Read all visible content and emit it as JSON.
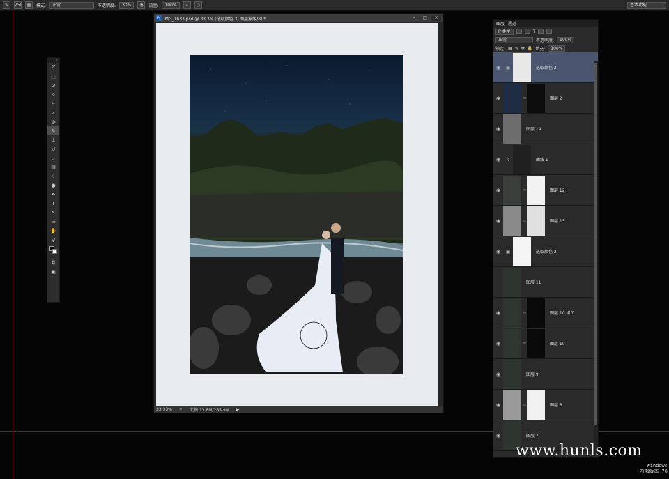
{
  "options_bar": {
    "brush_size": "250",
    "mode_label": "模式:",
    "mode_value": "正常",
    "opacity_label": "不透明度:",
    "opacity_value": "30%",
    "flow_label": "流量:",
    "flow_value": "100%",
    "workspace": "基本功能"
  },
  "document": {
    "title": "IMG_1633.psd @ 33.3% (选取颜色 3, 图层蒙版/8) *",
    "zoom": "33.33%",
    "doc_size": "文档:13.8M/265.9M"
  },
  "layers_panel": {
    "tabs": [
      "图层",
      "通道"
    ],
    "kind_filter": "P 类型",
    "blend_mode": "正常",
    "opacity_label": "不透明度:",
    "opacity_value": "100%",
    "lock_label": "锁定:",
    "fill_label": "填充:",
    "fill_value": "100%",
    "layers": [
      {
        "name": "选取颜色 3",
        "selected": true
      },
      {
        "name": "图层 2",
        "selected": false
      },
      {
        "name": "图层 14",
        "selected": false
      },
      {
        "name": "曲线 1",
        "selected": false
      },
      {
        "name": "图层 12",
        "selected": false
      },
      {
        "name": "图层 13",
        "selected": false
      },
      {
        "name": "选取颜色 2",
        "selected": false
      },
      {
        "name": "图层 11",
        "selected": false
      },
      {
        "name": "图层 10 拷贝",
        "selected": false
      },
      {
        "name": "图层 10",
        "selected": false
      },
      {
        "name": "图层 9",
        "selected": false
      },
      {
        "name": "图层 8",
        "selected": false
      },
      {
        "name": "图层 7",
        "selected": false
      }
    ]
  },
  "watermark": "www.hunls.com",
  "os_watermark": {
    "line1": "Windows",
    "line2": "内部版本 76"
  }
}
